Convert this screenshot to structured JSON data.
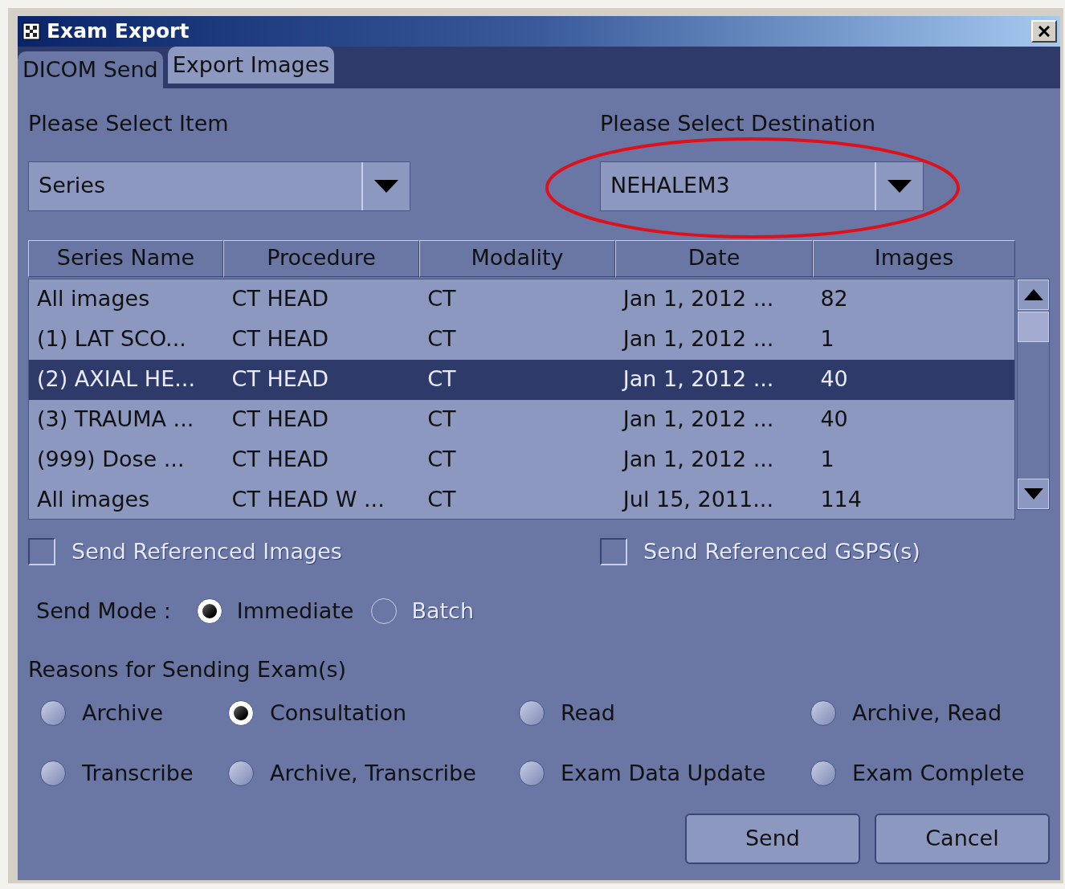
{
  "window": {
    "title": "Exam Export"
  },
  "tabs": [
    {
      "label": "DICOM Send",
      "selected": true
    },
    {
      "label": "Export Images",
      "selected": false
    }
  ],
  "item_select": {
    "label": "Please Select Item",
    "value": "Series"
  },
  "destination_select": {
    "label": "Please Select Destination",
    "value": "NEHALEM3",
    "highlighted": true
  },
  "table": {
    "columns": [
      "Series Name",
      "Procedure",
      "Modality",
      "Date",
      "Images"
    ],
    "rows": [
      {
        "cells": [
          "All images",
          "CT HEAD",
          "CT",
          "Jan 1, 2012 ...",
          "82"
        ],
        "selected": false
      },
      {
        "cells": [
          "(1) LAT SCO...",
          "CT HEAD",
          "CT",
          "Jan 1, 2012 ...",
          "1"
        ],
        "selected": false
      },
      {
        "cells": [
          "(2) AXIAL HE...",
          "CT HEAD",
          "CT",
          "Jan 1, 2012 ...",
          "40"
        ],
        "selected": true
      },
      {
        "cells": [
          "(3) TRAUMA ...",
          "CT HEAD",
          "CT",
          "Jan 1, 2012 ...",
          "40"
        ],
        "selected": false
      },
      {
        "cells": [
          "(999) Dose ...",
          "CT HEAD",
          "CT",
          "Jan 1, 2012 ...",
          "1"
        ],
        "selected": false
      },
      {
        "cells": [
          "All images",
          "CT HEAD W ...",
          "CT",
          "Jul 15, 2011...",
          "114"
        ],
        "selected": false
      }
    ]
  },
  "checkboxes": [
    {
      "label": "Send Referenced Images",
      "checked": false,
      "disabled": true
    },
    {
      "label": "Send Referenced GSPS(s)",
      "checked": false,
      "disabled": true
    }
  ],
  "send_mode": {
    "label": "Send Mode :",
    "options": [
      {
        "label": "Immediate",
        "selected": true,
        "disabled": false
      },
      {
        "label": "Batch",
        "selected": false,
        "disabled": true
      }
    ]
  },
  "reasons": {
    "label": "Reasons for Sending Exam(s)",
    "options": [
      {
        "label": "Archive",
        "selected": false
      },
      {
        "label": "Consultation",
        "selected": true
      },
      {
        "label": "Read",
        "selected": false
      },
      {
        "label": "Archive, Read",
        "selected": false
      },
      {
        "label": "Transcribe",
        "selected": false
      },
      {
        "label": "Archive, Transcribe",
        "selected": false
      },
      {
        "label": "Exam Data Update",
        "selected": false
      },
      {
        "label": "Exam Complete",
        "selected": false
      }
    ]
  },
  "buttons": [
    {
      "label": "Send"
    },
    {
      "label": "Cancel"
    }
  ]
}
